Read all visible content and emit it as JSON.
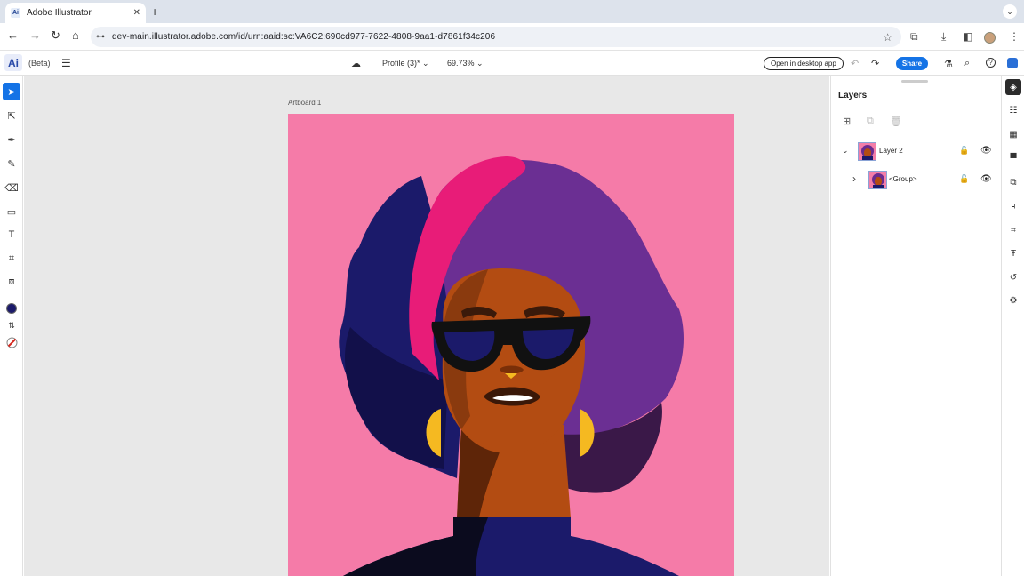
{
  "browser": {
    "tab_title": "Adobe Illustrator",
    "tab_favicon": "Ai",
    "tab_close_glyph": "✕",
    "new_tab_glyph": "+",
    "tab_menu_glyph": "⌄",
    "url": "dev-main.illustrator.adobe.com/id/urn:aaid:sc:VA6C2:690cd977-7622-4808-9aa1-d7861f34c206",
    "icons": {
      "back": "←",
      "forward": "→",
      "reload": "↻",
      "home": "⌂",
      "site_settings": "⊶",
      "star": "☆",
      "extensions": "⧉",
      "download": "⤓",
      "sidebar": "◧",
      "menu": "⋮"
    }
  },
  "appbar": {
    "logo": "Ai",
    "beta": "(Beta)",
    "menu_glyph": "☰",
    "cloud_glyph": "☁",
    "document_name": "Profile (3)* ⌄",
    "zoom": "69.73% ⌄",
    "open_desktop": "Open in desktop app",
    "undo_glyph": "↶",
    "redo_glyph": "↷",
    "share": "Share",
    "labs_glyph": "⚗",
    "search_glyph": "⌕",
    "help_glyph": "?"
  },
  "tools": [
    {
      "name": "selection-tool",
      "glyph": "➤",
      "active": true
    },
    {
      "name": "direct-selection-tool",
      "glyph": "⇱"
    },
    {
      "name": "pen-tool",
      "glyph": "✒"
    },
    {
      "name": "pencil-tool",
      "glyph": "✎"
    },
    {
      "name": "eraser-tool",
      "glyph": "⌫"
    },
    {
      "name": "rectangle-tool",
      "glyph": "▭"
    },
    {
      "name": "type-tool",
      "glyph": "T"
    },
    {
      "name": "crop-tool",
      "glyph": "⌗"
    },
    {
      "name": "image-trace-tool",
      "glyph": "⧈"
    }
  ],
  "colors": {
    "fill": "#1b1a6a",
    "swap_glyph": "⇅",
    "stroke_none_glyph": "⧄",
    "accent": "#1473e6"
  },
  "canvas": {
    "artboard_label": "Artboard 1"
  },
  "layers_panel": {
    "title": "Layers",
    "actions": {
      "add": "⊞",
      "duplicate": "⧉",
      "delete": "🗑"
    },
    "rows": [
      {
        "chevron": "⌄",
        "name": "Layer 2",
        "lock": "🔓",
        "eye": "👁"
      },
      {
        "chevron": "›",
        "name": "<Group>",
        "lock": "🔓",
        "eye": "👁"
      }
    ]
  },
  "right_strip": [
    {
      "name": "layers-panel-icon",
      "glyph": "◈",
      "active": true
    },
    {
      "name": "properties-icon",
      "glyph": "☷"
    },
    {
      "name": "swatches-icon",
      "glyph": "▦"
    },
    {
      "name": "comments-icon",
      "glyph": "▀"
    },
    {
      "name": "pathfinder-icon",
      "glyph": "⧉"
    },
    {
      "name": "align-icon",
      "glyph": "⫞"
    },
    {
      "name": "transform-icon",
      "glyph": "⌗"
    },
    {
      "name": "character-icon",
      "glyph": "Ŧ"
    },
    {
      "name": "paths-icon",
      "glyph": "↺"
    },
    {
      "name": "settings-icon",
      "glyph": "⚙"
    }
  ]
}
